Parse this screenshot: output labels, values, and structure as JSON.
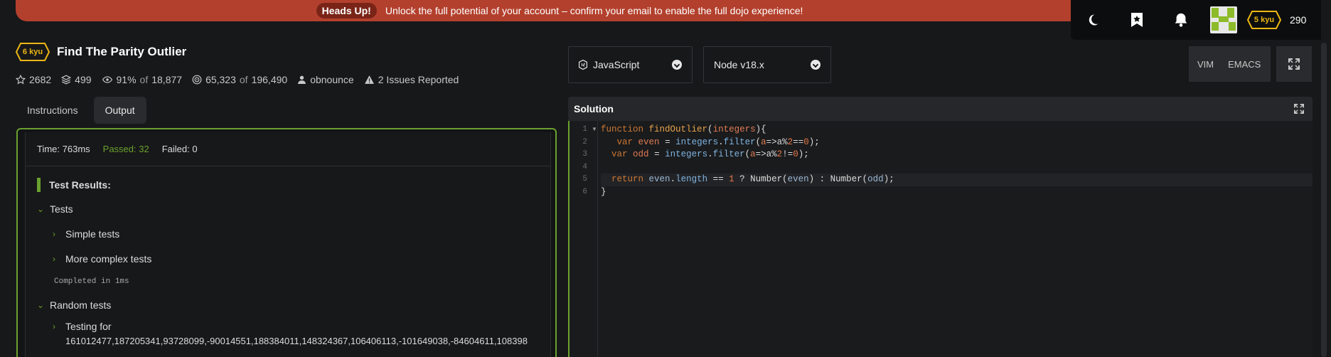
{
  "banner": {
    "pill": "Heads Up!",
    "message": "Unlock the full potential of your account – confirm your email to enable the full dojo experience!"
  },
  "topbar": {
    "rank": "5 kyu",
    "honor": "290"
  },
  "kata": {
    "rank": "6 kyu",
    "title": "Find The Parity Outlier",
    "stars": "2682",
    "collections": "499",
    "satisfaction_pct": "91%",
    "satisfaction_of": "of",
    "satisfaction_total": "18,877",
    "completed": "65,323",
    "completed_of": "of",
    "completed_total": "196,490",
    "author": "obnounce",
    "issues": "2 Issues Reported"
  },
  "tabs": [
    {
      "label": "Instructions"
    },
    {
      "label": "Output"
    }
  ],
  "output": {
    "time": "Time: 763ms",
    "passed": "Passed: 32",
    "failed": "Failed: 0",
    "results_title": "Test Results:",
    "groups": [
      {
        "label": "Tests"
      },
      {
        "label": "Simple tests"
      },
      {
        "label": "More complex tests"
      },
      {
        "label": "Completed in 1ms"
      },
      {
        "label": "Random tests"
      },
      {
        "label": "Testing for"
      },
      {
        "label": "161012477,187205341,93728099,-90014551,188384011,148324367,106406113,-101649038,-84604611,108398"
      }
    ]
  },
  "editor": {
    "language": "JavaScript",
    "runtime": "Node v18.x",
    "modes": [
      "VIM",
      "EMACS"
    ],
    "panel_title": "Solution",
    "line_numbers": [
      "1",
      "2",
      "3",
      "4",
      "5",
      "6"
    ]
  },
  "colors": {
    "accent_green": "#6aa12e",
    "banner_red": "#b3402d",
    "rank_yellow": "#ecb613"
  }
}
